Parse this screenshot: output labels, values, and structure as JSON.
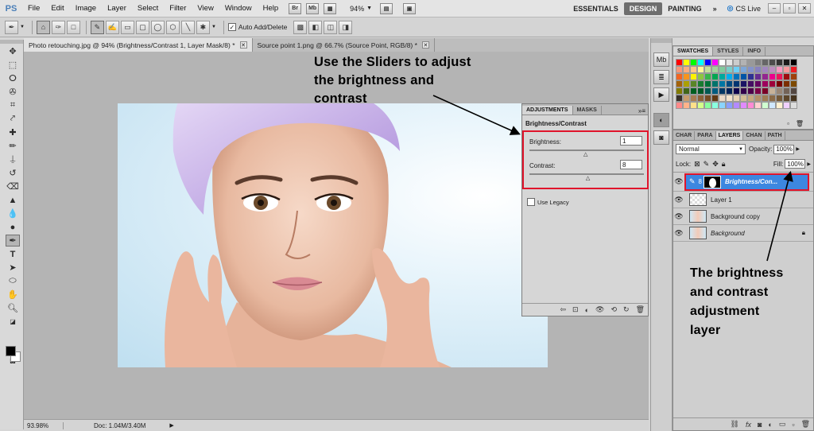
{
  "app": {
    "logo": "PS"
  },
  "menu": [
    "File",
    "Edit",
    "Image",
    "Layer",
    "Select",
    "Filter",
    "View",
    "Window",
    "Help"
  ],
  "menu_buttons": {
    "bridge": "Br",
    "mini_bridge": "Mb"
  },
  "zoom_value": "94%",
  "workspaces": {
    "essentials": "ESSENTIALS",
    "design": "DESIGN",
    "painting": "PAINTING",
    "more": "»"
  },
  "cs_live": "CS Live",
  "options_bar": {
    "auto_add_delete": "Auto Add/Delete",
    "auto_add_checked": "✓"
  },
  "doc_tabs": [
    {
      "label": "Photo retouching.jpg @ 94% (Brightness/Contrast 1, Layer Mask/8) *"
    },
    {
      "label": "Source point 1.png @ 66.7% (Source Point, RGB/8) *"
    }
  ],
  "annotations": {
    "sliders": [
      "Use the Sliders to adjust",
      "the brightness and",
      "contrast"
    ],
    "layer": [
      "The brightness",
      "and contrast",
      "adjustment",
      "layer"
    ]
  },
  "adjustments": {
    "tabs": [
      "ADJUSTMENTS",
      "MASKS"
    ],
    "title": "Brightness/Contrast",
    "brightness_label": "Brightness:",
    "brightness_value": "1",
    "brightness_fraction": 0.5,
    "contrast_label": "Contrast:",
    "contrast_value": "8",
    "contrast_fraction": 0.52,
    "use_legacy": "Use Legacy"
  },
  "swatches_panel": {
    "tabs": [
      "SWATCHES",
      "STYLES",
      "INFO"
    ]
  },
  "layers_panel": {
    "tabs": [
      "CHAR",
      "PARA",
      "LAYERS",
      "CHAN",
      "PATH"
    ],
    "blend_mode": "Normal",
    "opacity_label": "Opacity:",
    "opacity_value": "100%",
    "lock_label": "Lock:",
    "fill_label": "Fill:",
    "fill_value": "100%",
    "layers": [
      {
        "name": "Brightness/Con...",
        "selected": true
      },
      {
        "name": "Layer 1"
      },
      {
        "name": "Background copy"
      },
      {
        "name": "Background",
        "italic": true
      }
    ]
  },
  "status": {
    "zoom": "93.98%",
    "doc": "Doc: 1.04M/3.40M"
  },
  "colors": {
    "annotation_red": "#e0142b",
    "layer_highlight": "#3d87e0",
    "ps_blue": "#4b7fb8"
  }
}
